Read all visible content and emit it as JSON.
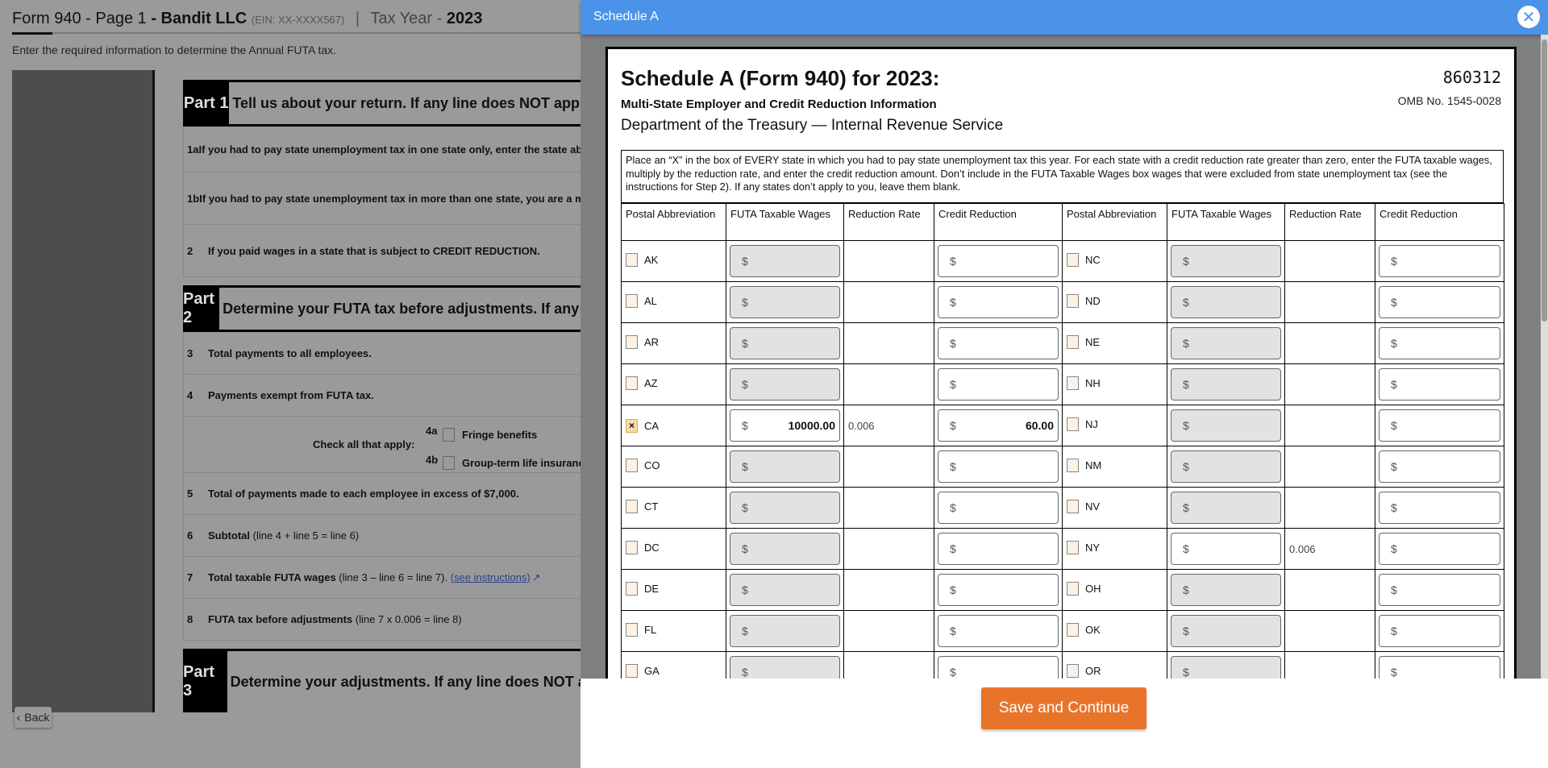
{
  "page": {
    "form_label": "Form 940 - Page 1",
    "company": "Bandit LLC",
    "ein": "(EIN: XX-XXXX567)",
    "separator": "|",
    "tax_year_label": "Tax Year -",
    "tax_year": "2023",
    "subtitle": "Enter the required information to determine the Annual FUTA tax.",
    "back_label": "Back",
    "parts": [
      {
        "label": "Part 1",
        "text": "Tell us about your return. If any line does NOT apply, leave it blank."
      },
      {
        "label": "Part 2",
        "text": "Determine your FUTA tax before adjustments. If any line does NOT apply, leave it blank."
      },
      {
        "label": "Part 3",
        "text": "Determine your adjustments. If any line does NOT apply, leave it blank."
      }
    ],
    "lines": {
      "l1a": {
        "n": "1a",
        "text": "If you had to pay state unemployment tax in one state only, enter the state abbreviation"
      },
      "l1b": {
        "n": "1b",
        "text": "If you had to pay state unemployment tax in more than one state, you are a multi-state employer"
      },
      "l2": {
        "n": "2",
        "text": "If you paid wages in a state that is subject to CREDIT REDUCTION."
      },
      "l3": {
        "n": "3",
        "text": "Total payments to all employees."
      },
      "l4": {
        "n": "4",
        "text": "Payments exempt from FUTA tax."
      },
      "l4check": {
        "label": "Check all that apply:",
        "a_n": "4a",
        "a_text": "Fringe benefits",
        "b_n": "4b",
        "b_text": "Group-term life insurance"
      },
      "l5": {
        "n": "5",
        "text": "Total of payments made to each employee in excess of $7,000."
      },
      "l6": {
        "n": "6",
        "bold": "Subtotal",
        "text": " (line 4 + line 5 = line 6)"
      },
      "l7": {
        "n": "7",
        "bold": "Total taxable FUTA wages",
        "text": " (line 3 – line 6 = line 7). ",
        "link": "(see instructions)"
      },
      "l8": {
        "n": "8",
        "bold": "FUTA tax before adjustments",
        "text": " (line 7 x 0.006 = line 8)"
      }
    }
  },
  "modal": {
    "title": "Schedule A",
    "close_icon": "close-circle-icon",
    "form_title": "Schedule A (Form 940) for 2023:",
    "form_subtitle": "Multi-State Employer and Credit Reduction Information",
    "department": "Department of the Treasury — Internal Revenue Service",
    "form_number": "860312",
    "omb": "OMB No. 1545-0028",
    "instructions": "Place an “X” in the box of EVERY state in which you had to pay state unemployment tax this year. For each state with a credit reduction rate greater than zero, enter the FUTA taxable wages, multiply by the reduction rate, and enter the credit reduction amount. Don’t include in the FUTA Taxable Wages box wages that were excluded from state unemployment tax (see the instructions for Step 2). If any states don’t apply to you, leave them blank.",
    "columns": [
      "Postal Abbreviation",
      "FUTA Taxable Wages",
      "Reduction Rate",
      "Credit Reduction",
      "Postal Abbreviation",
      "FUTA Taxable Wages",
      "Reduction Rate",
      "Credit Reduction"
    ],
    "currency": "$",
    "rows": [
      [
        {
          "state": "AK",
          "checked": false,
          "wages": "",
          "enabled": false,
          "rate": "",
          "credit": ""
        },
        {
          "state": "NC",
          "checked": false,
          "wages": "",
          "enabled": false,
          "rate": "",
          "credit": ""
        }
      ],
      [
        {
          "state": "AL",
          "checked": false,
          "wages": "",
          "enabled": false,
          "rate": "",
          "credit": ""
        },
        {
          "state": "ND",
          "checked": false,
          "wages": "",
          "enabled": false,
          "rate": "",
          "credit": ""
        }
      ],
      [
        {
          "state": "AR",
          "checked": false,
          "wages": "",
          "enabled": false,
          "rate": "",
          "credit": ""
        },
        {
          "state": "NE",
          "checked": false,
          "wages": "",
          "enabled": false,
          "rate": "",
          "credit": ""
        }
      ],
      [
        {
          "state": "AZ",
          "checked": false,
          "wages": "",
          "enabled": false,
          "rate": "",
          "credit": ""
        },
        {
          "state": "NH",
          "checked": false,
          "wages": "",
          "enabled": false,
          "rate": "",
          "credit": ""
        }
      ],
      [
        {
          "state": "CA",
          "checked": true,
          "wages": "10000.00",
          "enabled": true,
          "rate": "0.006",
          "credit": "60.00"
        },
        {
          "state": "NJ",
          "checked": false,
          "wages": "",
          "enabled": false,
          "rate": "",
          "credit": ""
        }
      ],
      [
        {
          "state": "CO",
          "checked": false,
          "wages": "",
          "enabled": false,
          "rate": "",
          "credit": ""
        },
        {
          "state": "NM",
          "checked": false,
          "wages": "",
          "enabled": false,
          "rate": "",
          "credit": ""
        }
      ],
      [
        {
          "state": "CT",
          "checked": false,
          "wages": "",
          "enabled": false,
          "rate": "",
          "credit": ""
        },
        {
          "state": "NV",
          "checked": false,
          "wages": "",
          "enabled": false,
          "rate": "",
          "credit": ""
        }
      ],
      [
        {
          "state": "DC",
          "checked": false,
          "wages": "",
          "enabled": false,
          "rate": "",
          "credit": ""
        },
        {
          "state": "NY",
          "checked": false,
          "wages": "",
          "enabled": true,
          "rate": "0.006",
          "credit": ""
        }
      ],
      [
        {
          "state": "DE",
          "checked": false,
          "wages": "",
          "enabled": false,
          "rate": "",
          "credit": ""
        },
        {
          "state": "OH",
          "checked": false,
          "wages": "",
          "enabled": false,
          "rate": "",
          "credit": ""
        }
      ],
      [
        {
          "state": "FL",
          "checked": false,
          "wages": "",
          "enabled": false,
          "rate": "",
          "credit": ""
        },
        {
          "state": "OK",
          "checked": false,
          "wages": "",
          "enabled": false,
          "rate": "",
          "credit": ""
        }
      ],
      [
        {
          "state": "GA",
          "checked": false,
          "wages": "",
          "enabled": false,
          "rate": "",
          "credit": ""
        },
        {
          "state": "OR",
          "checked": false,
          "wages": "",
          "enabled": false,
          "rate": "",
          "credit": ""
        }
      ]
    ],
    "save_label": "Save and Continue"
  },
  "colors": {
    "header_blue": "#4a93e8",
    "save_orange": "#e8742c",
    "disabled_input": "#e2e2e2"
  }
}
